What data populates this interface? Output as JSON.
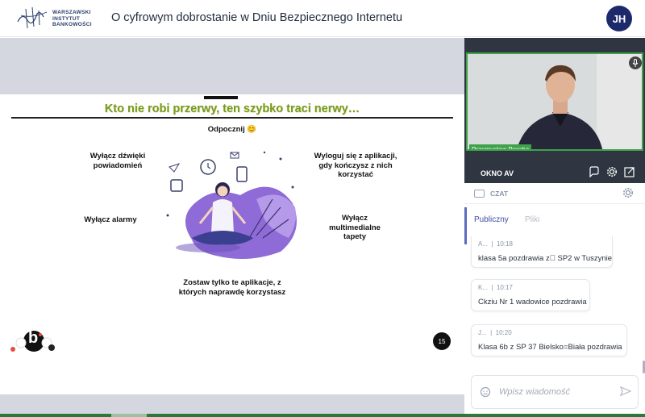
{
  "header": {
    "logo_lines": [
      "WARSZAWSKI",
      "INSTYTUT",
      "BANKOWOŚCI"
    ],
    "title": "O cyfrowym dobrostanie w Dniu Bezpiecznego Internetu",
    "avatar_initials": "JH"
  },
  "slide": {
    "title": "Kto nie robi przerwy, ten szybko traci nerwy…",
    "items": {
      "rest": "Odpocznij 😊",
      "sounds": "Wyłącz dźwięki powiadomień",
      "logout": "Wyloguj się z aplikacji, gdy kończysz z nich korzystać",
      "alarms": "Wyłącz alarmy",
      "wallpapers": "Wyłącz multimedialne tapety",
      "keep_apps": "Zostaw tylko te aplikacje, z których naprawdę korzystasz"
    },
    "page_number": "15",
    "badge_letter": "b"
  },
  "video": {
    "presenter_name": "Przemysław Poręba",
    "window_label": "OKNO AV"
  },
  "chat": {
    "header_label": "CZAT",
    "tabs": [
      "Publiczny",
      "Pliki"
    ],
    "active_tab": "Publiczny",
    "messages": [
      {
        "author": "A...",
        "time": "10:18",
        "text": "klasa 5a pozdrawia z\u0000 SP2 w Tuszynie"
      },
      {
        "author": "K...",
        "time": "10:17",
        "text": "Ckziu Nr 1 wadowice pozdrawia"
      },
      {
        "author": "J...",
        "time": "10:20",
        "text": "Klasa 6b z  SP 37  Bielsko=Biała pozdrawia"
      }
    ],
    "input_placeholder": "Wpisz wiadomość"
  },
  "colors": {
    "accent": "#3ea24a",
    "avatar_bg": "#1c2a6b",
    "slide_title": "#7a9a22",
    "tab_active": "#5c6bc0"
  }
}
